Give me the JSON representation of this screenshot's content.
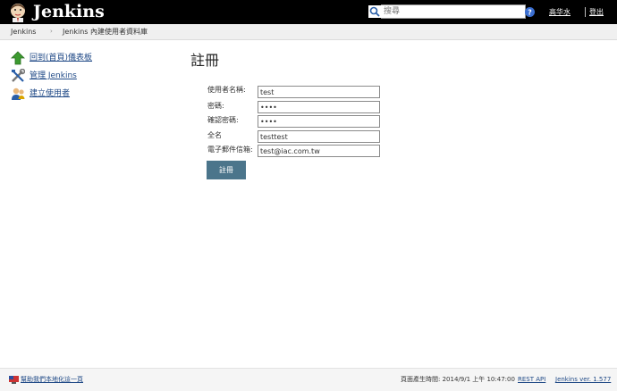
{
  "header": {
    "brand": "Jenkins",
    "search_placeholder": "搜尋",
    "search_value": "",
    "user_name": "高华水",
    "logout_label": "登出"
  },
  "breadcrumb": {
    "items": [
      "Jenkins",
      "Jenkins 內建使用者資料庫"
    ],
    "separator": "›"
  },
  "tasks": [
    {
      "label": "回到(首頁)儀表板",
      "icon": "up-arrow-icon"
    },
    {
      "label": "管理 Jenkins",
      "icon": "tools-icon"
    },
    {
      "label": "建立使用者",
      "icon": "new-user-icon"
    }
  ],
  "main": {
    "title": "註冊",
    "form": {
      "username_label": "使用者名稱:",
      "username_value": "test",
      "password_label": "密碼:",
      "password_value": "test",
      "confirm_label": "確認密碼:",
      "confirm_value": "test",
      "fullname_label": "全名",
      "fullname_value": "testtest",
      "email_label": "電子郵件信箱:",
      "email_value": "test@iac.com.tw",
      "submit_label": "註冊"
    }
  },
  "footer": {
    "localize_label": "幫助我們本地化這一頁",
    "generated_text": "頁面產生時間: 2014/9/1 上午 10:47:00",
    "rest_api_label": "REST API",
    "version_label": "Jenkins ver. 1.577"
  },
  "colors": {
    "header_bg": "#000000",
    "button_bg": "#4b758b",
    "link": "#204a87",
    "breadcrumb_bg": "#f0f0f0"
  }
}
